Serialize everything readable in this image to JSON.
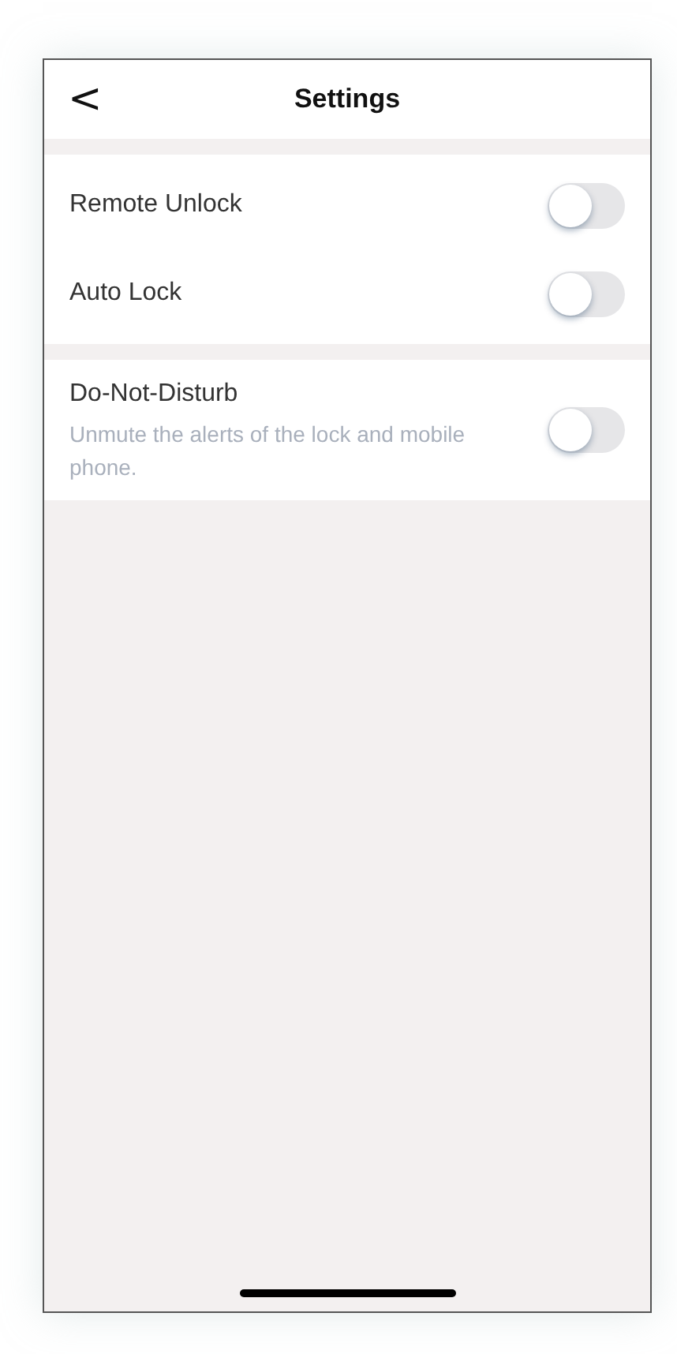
{
  "header": {
    "back": "<",
    "title": "Settings"
  },
  "sections": [
    {
      "rows": [
        {
          "label": "Remote Unlock",
          "on": false
        },
        {
          "label": "Auto Lock",
          "on": false
        }
      ]
    },
    {
      "rows": [
        {
          "label": "Do-Not-Disturb",
          "description": "Unmute the alerts of the lock and mobile phone.",
          "on": false
        }
      ]
    }
  ]
}
